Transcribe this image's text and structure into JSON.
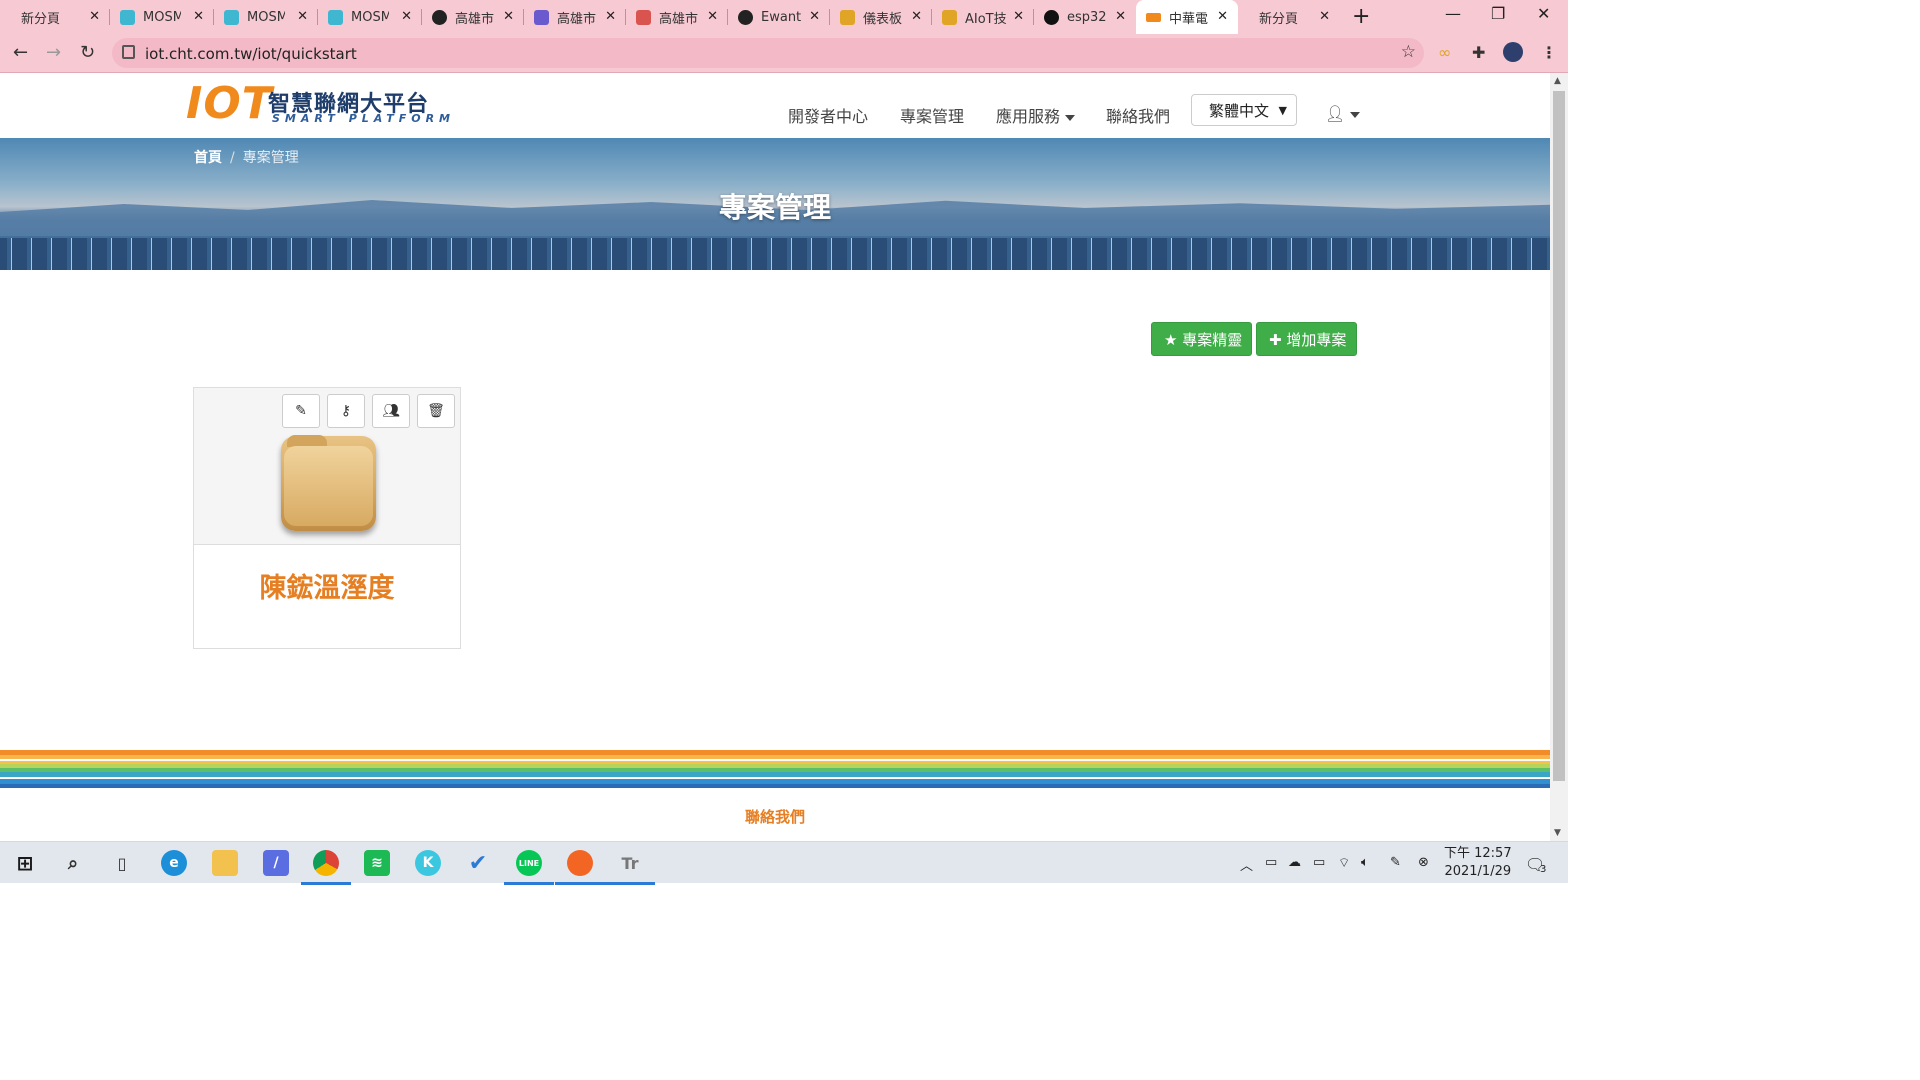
{
  "browser": {
    "tabs": [
      {
        "title": "新分頁",
        "color": "#f7c9d3",
        "active": false
      },
      {
        "title": "MOSME",
        "color": "#3fb7d1",
        "active": false
      },
      {
        "title": "MOSME",
        "color": "#3fb7d1",
        "active": false
      },
      {
        "title": "MOSME",
        "color": "#3fb7d1",
        "active": false
      },
      {
        "title": "高雄市",
        "color": "#222222",
        "active": false
      },
      {
        "title": "高雄市",
        "color": "#6a5acd",
        "active": false
      },
      {
        "title": "高雄市",
        "color": "#d9534f",
        "active": false
      },
      {
        "title": "Ewant",
        "color": "#222222",
        "active": false
      },
      {
        "title": "儀表板",
        "color": "#e0a526",
        "active": false
      },
      {
        "title": "AIoT技",
        "color": "#e0a526",
        "active": false
      },
      {
        "title": "esp32",
        "color": "#111111",
        "active": false
      },
      {
        "title": "中華電",
        "color": "#f08a1c",
        "active": true
      },
      {
        "title": "新分頁",
        "color": "#f7c9d3",
        "active": false
      }
    ],
    "url": "iot.cht.com.tw/iot/quickstart"
  },
  "site": {
    "logo_main": "IOT",
    "logo_title": "智慧聯網大平台",
    "logo_sub": "SMART PLATFORM",
    "nav": {
      "developer": "開發者中心",
      "projects": "專案管理",
      "services": "應用服務",
      "contact": "聯絡我們"
    },
    "language": "繁體中文"
  },
  "breadcrumb": {
    "home": "首頁",
    "separator": "/",
    "current": "專案管理"
  },
  "page_title": "專案管理",
  "actions": {
    "wizard": "專案精靈",
    "add": "增加專案"
  },
  "project_card": {
    "name": "陳鋐溫溼度"
  },
  "footer": {
    "contact": "聯絡我們"
  },
  "taskbar": {
    "time": "下午 12:57",
    "date": "2021/1/29",
    "notifications": "3"
  },
  "colors": {
    "accent_green": "#3fae49",
    "accent_orange": "#e67e22",
    "tab_pink": "#f7c9d3"
  }
}
